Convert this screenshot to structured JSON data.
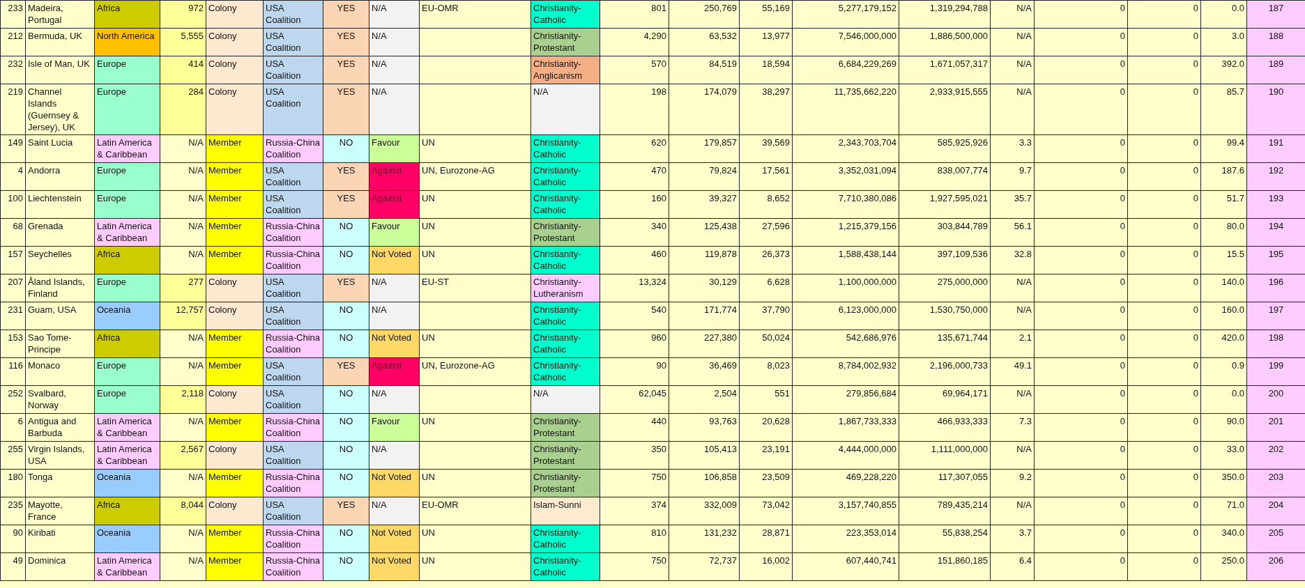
{
  "table": {
    "rows": [
      {
        "cells": [
          "233",
          "Madeira, Portugal",
          {
            "text": "Africa",
            "color": "#cccc00"
          },
          {
            "text": "972",
            "color": "#ffff99"
          },
          {
            "text": "Colony",
            "color": "#fde9d0"
          },
          {
            "text": "USA Coalition",
            "color": "#bdd7ee"
          },
          {
            "text": "YES",
            "color": "#fcd5b4"
          },
          {
            "text": "N/A",
            "color": "#f2f2f2"
          },
          "EU-OMR",
          {
            "text": "Christianity-Catholic",
            "color": "#00ffcc"
          },
          "801",
          "250,769",
          "55,169",
          "5,277,179,152",
          "1,319,294,788",
          "N/A",
          "0",
          "0",
          "0.0",
          "187"
        ]
      },
      {
        "cells": [
          "212",
          "Bermuda, UK",
          {
            "text": "North America",
            "color": "#ffc000"
          },
          {
            "text": "5,555",
            "color": "#ffff99"
          },
          {
            "text": "Colony",
            "color": "#fde9d0"
          },
          {
            "text": "USA Coalition",
            "color": "#bdd7ee"
          },
          {
            "text": "YES",
            "color": "#fcd5b4"
          },
          {
            "text": "N/A",
            "color": "#f2f2f2"
          },
          null,
          {
            "text": "Christianity-Protestant",
            "color": "#a9d08e"
          },
          "4,290",
          "63,532",
          "13,977",
          "7,546,000,000",
          "1,886,500,000",
          "N/A",
          "0",
          "0",
          "3.0",
          "188"
        ]
      },
      {
        "cells": [
          "232",
          "Isle of Man, UK",
          {
            "text": "Europe",
            "color": "#99ffcc"
          },
          {
            "text": "414",
            "color": "#ffff99"
          },
          {
            "text": "Colony",
            "color": "#fde9d0"
          },
          {
            "text": "USA Coalition",
            "color": "#bdd7ee"
          },
          {
            "text": "YES",
            "color": "#fcd5b4"
          },
          {
            "text": "N/A",
            "color": "#f2f2f2"
          },
          null,
          {
            "text": "Christianity-Anglicanism",
            "color": "#f4b084"
          },
          "570",
          "84,519",
          "18,594",
          "6,684,229,269",
          "1,671,057,317",
          "N/A",
          "0",
          "0",
          "392.0",
          "189"
        ]
      },
      {
        "cells": [
          "219",
          "Channel Islands (Guernsey & Jersey), UK",
          {
            "text": "Europe",
            "color": "#99ffcc"
          },
          {
            "text": "284",
            "color": "#ffff99"
          },
          {
            "text": "Colony",
            "color": "#fde9d0"
          },
          {
            "text": "USA Coalition",
            "color": "#bdd7ee"
          },
          {
            "text": "YES",
            "color": "#fcd5b4"
          },
          {
            "text": "N/A",
            "color": "#f2f2f2"
          },
          null,
          {
            "text": "N/A",
            "color": "#f2f2f2"
          },
          "198",
          "174,079",
          "38,297",
          "11,735,662,220",
          "2,933,915,555",
          "N/A",
          "0",
          "0",
          "85.7",
          "190"
        ]
      },
      {
        "cells": [
          "149",
          "Saint Lucia",
          {
            "text": "Latin America & Caribbean",
            "color": "#ffccff"
          },
          "N/A",
          {
            "text": "Member",
            "color": "#ffff00"
          },
          {
            "text": "Russia-China Coalition",
            "color": "#ffccff"
          },
          {
            "text": "NO",
            "color": "#ccffff"
          },
          {
            "text": "Favour",
            "color": "#ccff99"
          },
          "UN",
          {
            "text": "Christianity-Catholic",
            "color": "#00ffcc"
          },
          "620",
          "179,857",
          "39,569",
          "2,343,703,704",
          "585,925,926",
          "3.3",
          "0",
          "0",
          "99.4",
          "191"
        ]
      },
      {
        "cells": [
          "4",
          "Andorra",
          {
            "text": "Europe",
            "color": "#99ffcc"
          },
          "N/A",
          {
            "text": "Member",
            "color": "#ffff00"
          },
          {
            "text": "USA Coalition",
            "color": "#bdd7ee"
          },
          {
            "text": "YES",
            "color": "#fcd5b4"
          },
          {
            "text": "Against",
            "color": "#ff0066"
          },
          "UN, Eurozone-AG",
          {
            "text": "Christianity-Catholic",
            "color": "#00ffcc"
          },
          "470",
          "79,824",
          "17,561",
          "3,352,031,094",
          "838,007,774",
          "9.7",
          "0",
          "0",
          "187.6",
          "192"
        ]
      },
      {
        "cells": [
          "100",
          "Liechtenstein",
          {
            "text": "Europe",
            "color": "#99ffcc"
          },
          "N/A",
          {
            "text": "Member",
            "color": "#ffff00"
          },
          {
            "text": "USA Coalition",
            "color": "#bdd7ee"
          },
          {
            "text": "YES",
            "color": "#fcd5b4"
          },
          {
            "text": "Against",
            "color": "#ff0066"
          },
          "UN",
          {
            "text": "Christianity-Catholic",
            "color": "#00ffcc"
          },
          "160",
          "39,327",
          "8,652",
          "7,710,380,086",
          "1,927,595,021",
          "35.7",
          "0",
          "0",
          "51.7",
          "193"
        ]
      },
      {
        "cells": [
          "68",
          "Grenada",
          {
            "text": "Latin America & Caribbean",
            "color": "#ffccff"
          },
          "N/A",
          {
            "text": "Member",
            "color": "#ffff00"
          },
          {
            "text": "Russia-China Coalition",
            "color": "#ffccff"
          },
          {
            "text": "NO",
            "color": "#ccffff"
          },
          {
            "text": "Favour",
            "color": "#ccff99"
          },
          "UN",
          {
            "text": "Christianity-Protestant",
            "color": "#a9d08e"
          },
          "340",
          "125,438",
          "27,596",
          "1,215,379,156",
          "303,844,789",
          "56.1",
          "0",
          "0",
          "80.0",
          "194"
        ]
      },
      {
        "cells": [
          "157",
          "Seychelles",
          {
            "text": "Africa",
            "color": "#cccc00"
          },
          "N/A",
          {
            "text": "Member",
            "color": "#ffff00"
          },
          {
            "text": "Russia-China Coalition",
            "color": "#ffccff"
          },
          {
            "text": "NO",
            "color": "#ccffff"
          },
          {
            "text": "Not Voted",
            "color": "#ffd966"
          },
          "UN",
          {
            "text": "Christianity-Catholic",
            "color": "#00ffcc"
          },
          "460",
          "119,878",
          "26,373",
          "1,588,438,144",
          "397,109,536",
          "32.8",
          "0",
          "0",
          "15.5",
          "195"
        ]
      },
      {
        "cells": [
          "207",
          "Åland Islands, Finland",
          {
            "text": "Europe",
            "color": "#99ffcc"
          },
          {
            "text": "277",
            "color": "#ffff99"
          },
          {
            "text": "Colony",
            "color": "#fde9d0"
          },
          {
            "text": "USA Coalition",
            "color": "#bdd7ee"
          },
          {
            "text": "YES",
            "color": "#fcd5b4"
          },
          {
            "text": "N/A",
            "color": "#f2f2f2"
          },
          "EU-ST",
          {
            "text": "Christianity-Lutheranism",
            "color": "#ffccff"
          },
          "13,324",
          "30,129",
          "6,628",
          "1,100,000,000",
          "275,000,000",
          "N/A",
          "0",
          "0",
          "140.0",
          "196"
        ]
      },
      {
        "cells": [
          "231",
          "Guam, USA",
          {
            "text": "Oceania",
            "color": "#99ccff"
          },
          {
            "text": "12,757",
            "color": "#ffff99"
          },
          {
            "text": "Colony",
            "color": "#fde9d0"
          },
          {
            "text": "USA Coalition",
            "color": "#bdd7ee"
          },
          {
            "text": "NO",
            "color": "#ccffff"
          },
          {
            "text": "N/A",
            "color": "#f2f2f2"
          },
          null,
          {
            "text": "Christianity-Catholic",
            "color": "#00ffcc"
          },
          "540",
          "171,774",
          "37,790",
          "6,123,000,000",
          "1,530,750,000",
          "N/A",
          "0",
          "0",
          "160.0",
          "197"
        ]
      },
      {
        "cells": [
          "153",
          "Sao Tome-Principe",
          {
            "text": "Africa",
            "color": "#cccc00"
          },
          "N/A",
          {
            "text": "Member",
            "color": "#ffff00"
          },
          {
            "text": "Russia-China Coalition",
            "color": "#ffccff"
          },
          {
            "text": "NO",
            "color": "#ccffff"
          },
          {
            "text": "Not Voted",
            "color": "#ffd966"
          },
          "UN",
          {
            "text": "Christianity-Catholic",
            "color": "#00ffcc"
          },
          "960",
          "227,380",
          "50,024",
          "542,686,976",
          "135,671,744",
          "2.1",
          "0",
          "0",
          "420.0",
          "198"
        ]
      },
      {
        "cells": [
          "116",
          "Monaco",
          {
            "text": "Europe",
            "color": "#99ffcc"
          },
          "N/A",
          {
            "text": "Member",
            "color": "#ffff00"
          },
          {
            "text": "USA Coalition",
            "color": "#bdd7ee"
          },
          {
            "text": "YES",
            "color": "#fcd5b4"
          },
          {
            "text": "Against",
            "color": "#ff0066"
          },
          "UN, Eurozone-AG",
          {
            "text": "Christianity-Catholic",
            "color": "#00ffcc"
          },
          "90",
          "36,469",
          "8,023",
          "8,784,002,932",
          "2,196,000,733",
          "49.1",
          "0",
          "0",
          "0.9",
          "199"
        ]
      },
      {
        "cells": [
          "252",
          "Svalbard, Norway",
          {
            "text": "Europe",
            "color": "#99ffcc"
          },
          {
            "text": "2,118",
            "color": "#ffff99"
          },
          {
            "text": "Colony",
            "color": "#fde9d0"
          },
          {
            "text": "USA Coalition",
            "color": "#bdd7ee"
          },
          {
            "text": "NO",
            "color": "#ccffff"
          },
          {
            "text": "N/A",
            "color": "#f2f2f2"
          },
          null,
          {
            "text": "N/A",
            "color": "#f2f2f2"
          },
          "62,045",
          "2,504",
          "551",
          "279,856,684",
          "69,964,171",
          "N/A",
          "0",
          "0",
          "0.0",
          "200"
        ]
      },
      {
        "cells": [
          "6",
          "Antigua and Barbuda",
          {
            "text": "Latin America & Caribbean",
            "color": "#ffccff"
          },
          "N/A",
          {
            "text": "Member",
            "color": "#ffff00"
          },
          {
            "text": "Russia-China Coalition",
            "color": "#ffccff"
          },
          {
            "text": "NO",
            "color": "#ccffff"
          },
          {
            "text": "Favour",
            "color": "#ccff99"
          },
          "UN",
          {
            "text": "Christianity-Protestant",
            "color": "#a9d08e"
          },
          "440",
          "93,763",
          "20,628",
          "1,867,733,333",
          "466,933,333",
          "7.3",
          "0",
          "0",
          "90.0",
          "201"
        ]
      },
      {
        "cells": [
          "255",
          "Virgin Islands, USA",
          {
            "text": "Latin America & Caribbean",
            "color": "#ffccff"
          },
          {
            "text": "2,567",
            "color": "#ffff99"
          },
          {
            "text": "Colony",
            "color": "#fde9d0"
          },
          {
            "text": "USA Coalition",
            "color": "#bdd7ee"
          },
          {
            "text": "NO",
            "color": "#ccffff"
          },
          {
            "text": "N/A",
            "color": "#f2f2f2"
          },
          null,
          {
            "text": "Christianity-Protestant",
            "color": "#a9d08e"
          },
          "350",
          "105,413",
          "23,191",
          "4,444,000,000",
          "1,111,000,000",
          "N/A",
          "0",
          "0",
          "33.0",
          "202"
        ]
      },
      {
        "cells": [
          "180",
          "Tonga",
          {
            "text": "Oceania",
            "color": "#99ccff"
          },
          "N/A",
          {
            "text": "Member",
            "color": "#ffff00"
          },
          {
            "text": "Russia-China Coalition",
            "color": "#ffccff"
          },
          {
            "text": "NO",
            "color": "#ccffff"
          },
          {
            "text": "Not Voted",
            "color": "#ffd966"
          },
          "UN",
          {
            "text": "Christianity-Protestant",
            "color": "#a9d08e"
          },
          "750",
          "106,858",
          "23,509",
          "469,228,220",
          "117,307,055",
          "9.2",
          "0",
          "0",
          "350.0",
          "203"
        ]
      },
      {
        "cells": [
          "235",
          "Mayotte, France",
          {
            "text": "Africa",
            "color": "#cccc00"
          },
          {
            "text": "8,044",
            "color": "#ffff99"
          },
          {
            "text": "Colony",
            "color": "#fde9d0"
          },
          {
            "text": "USA Coalition",
            "color": "#bdd7ee"
          },
          {
            "text": "YES",
            "color": "#fcd5b4"
          },
          {
            "text": "N/A",
            "color": "#f2f2f2"
          },
          "EU-OMR",
          {
            "text": "Islam-Sunni",
            "color": "#fdebd0"
          },
          "374",
          "332,009",
          "73,042",
          "3,157,740,855",
          "789,435,214",
          "N/A",
          "0",
          "0",
          "71.0",
          "204"
        ]
      },
      {
        "cells": [
          "90",
          "Kiribati",
          {
            "text": "Oceania",
            "color": "#99ccff"
          },
          "N/A",
          {
            "text": "Member",
            "color": "#ffff00"
          },
          {
            "text": "Russia-China Coalition",
            "color": "#ffccff"
          },
          {
            "text": "NO",
            "color": "#ccffff"
          },
          {
            "text": "Not Voted",
            "color": "#ffd966"
          },
          "UN",
          {
            "text": "Christianity-Catholic",
            "color": "#00ffcc"
          },
          "810",
          "131,232",
          "28,871",
          "223,353,014",
          "55,838,254",
          "3.7",
          "0",
          "0",
          "340.0",
          "205"
        ]
      },
      {
        "cells": [
          "49",
          "Dominica",
          {
            "text": "Latin America & Caribbean",
            "color": "#ffccff"
          },
          "N/A",
          {
            "text": "Member",
            "color": "#ffff00"
          },
          {
            "text": "Russia-China Coalition",
            "color": "#ffccff"
          },
          {
            "text": "NO",
            "color": "#ccffff"
          },
          {
            "text": "Not Voted",
            "color": "#ffd966"
          },
          "UN",
          {
            "text": "Christianity-Catholic",
            "color": "#00ffcc"
          },
          "750",
          "72,737",
          "16,002",
          "607,440,741",
          "151,860,185",
          "6.4",
          "0",
          "0",
          "250.0",
          "206"
        ]
      }
    ]
  }
}
